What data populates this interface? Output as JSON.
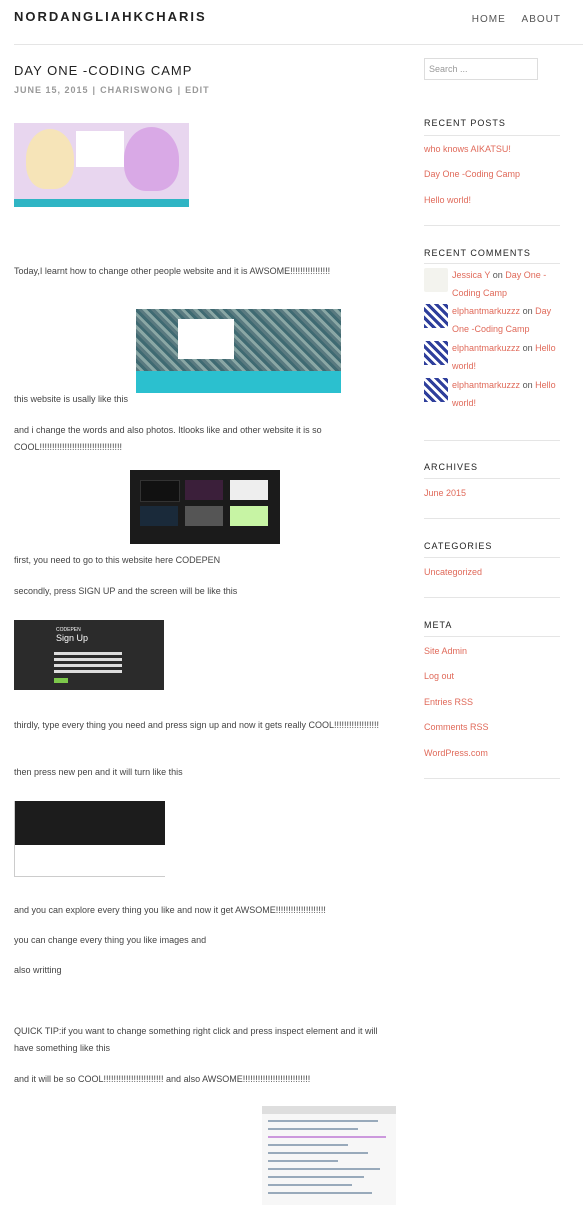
{
  "site": {
    "title": "NORDANGLIAHKCHARIS",
    "nav": [
      "HOME",
      "ABOUT"
    ]
  },
  "post": {
    "title": "DAY ONE -CODING CAMP",
    "date": "JUNE 15, 2015",
    "author": "CHARISWONG",
    "edit": "EDIT",
    "paragraphs": [
      "Today,I learnt how to change other people website and it is AWSOME!!!!!!!!!!!!!!!!",
      "this website is usally like this",
      "and i change the words and also photos. Itlooks like and other website it is so COOL!!!!!!!!!!!!!!!!!!!!!!!!!!!!!!!!!",
      "first, you need to go to this website here CODEPEN",
      "secondly, press SIGN UP and the screen will be like this",
      "thirdly, type every thing you need and press sign up and now it gets really COOL!!!!!!!!!!!!!!!!!!",
      "then press new pen and it will turn like this",
      "and you can explore every thing you like and now it get AWSOME!!!!!!!!!!!!!!!!!!!!",
      "you can change every thing you like images and",
      "also writting",
      "QUICK TIP:if you want to change something right click and press inspect element and it will have something like this",
      "and it will be so COOL!!!!!!!!!!!!!!!!!!!!!!!! and also AWSOME!!!!!!!!!!!!!!!!!!!!!!!!!!!"
    ],
    "images": {
      "codepen_logo": "CODEPEN",
      "signup_title": "Sign Up"
    }
  },
  "sidebar": {
    "search_placeholder": "Search ...",
    "recent_posts_title": "RECENT POSTS",
    "recent_posts": [
      "who knows AIKATSU!",
      "Day One -Coding Camp",
      "Hello world!"
    ],
    "recent_comments_title": "RECENT COMMENTS",
    "comments": [
      {
        "author": "Jessica Y",
        "on": "on",
        "post": "Day One -Coding Camp"
      },
      {
        "author": "elphantmarkuzzz",
        "on": "on",
        "post": "Day One -Coding Camp"
      },
      {
        "author": "elphantmarkuzzz",
        "on": "on",
        "post": "Hello world!"
      },
      {
        "author": "elphantmarkuzzz",
        "on": "on",
        "post": "Hello world!"
      }
    ],
    "archives_title": "ARCHIVES",
    "archives": [
      "June 2015"
    ],
    "categories_title": "CATEGORIES",
    "categories": [
      "Uncategorized"
    ],
    "meta_title": "META",
    "meta": [
      "Site Admin",
      "Log out",
      "Entries RSS",
      "Comments RSS",
      "WordPress.com"
    ]
  },
  "colors": {
    "link": "#e06a5a",
    "accent_teal": "#2fb5c4"
  }
}
